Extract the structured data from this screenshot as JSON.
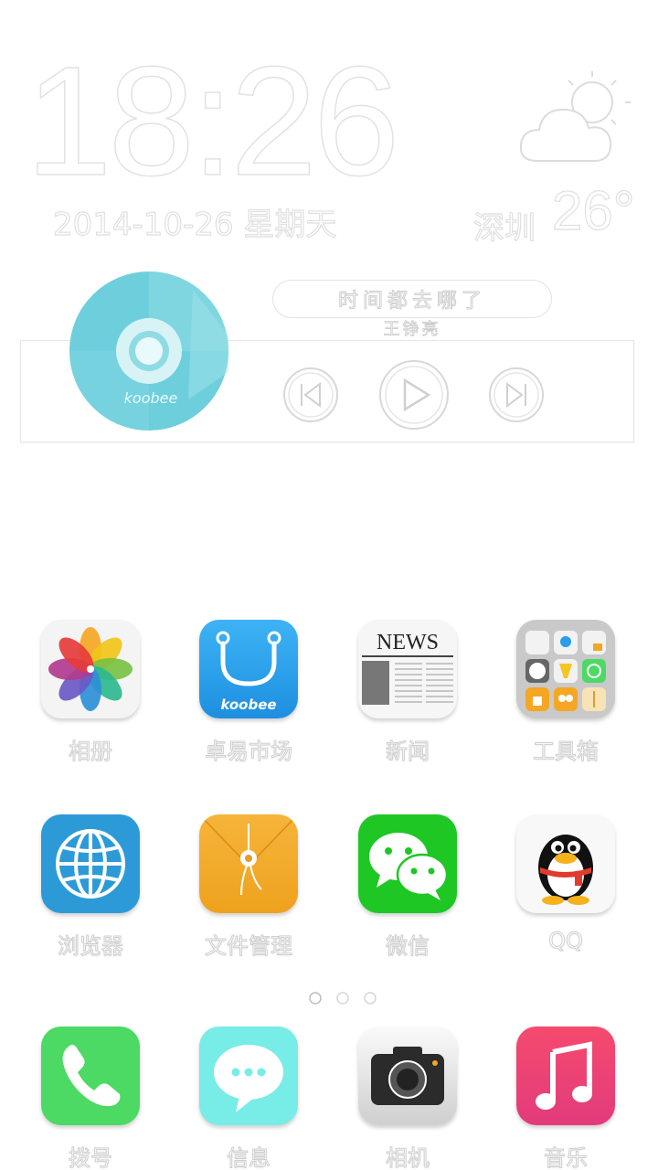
{
  "clock": {
    "time": "18:26",
    "date": "2014-10-26   星期天"
  },
  "weather": {
    "icon": "partly-cloudy-icon",
    "city": "深圳",
    "temperature": "26°"
  },
  "music": {
    "song_title": "时间都去哪了",
    "artist": "王铮亮",
    "disc_brand": "koobee",
    "state": "paused"
  },
  "apps": [
    {
      "label": "相册",
      "icon": "photos-icon"
    },
    {
      "label": "卓易市场",
      "icon": "koobee-market-icon",
      "brand": "koobee"
    },
    {
      "label": "新闻",
      "icon": "news-icon",
      "icon_text": "NEWS"
    },
    {
      "label": "工具箱",
      "icon": "toolbox-folder-icon"
    },
    {
      "label": "浏览器",
      "icon": "browser-globe-icon"
    },
    {
      "label": "文件管理",
      "icon": "file-manager-icon"
    },
    {
      "label": "微信",
      "icon": "wechat-icon"
    },
    {
      "label": "QQ",
      "icon": "qq-penguin-icon"
    }
  ],
  "page_indicator": {
    "pages": 3,
    "current": 1
  },
  "dock": [
    {
      "label": "拨号",
      "icon": "phone-icon"
    },
    {
      "label": "信息",
      "icon": "messages-icon"
    },
    {
      "label": "相机",
      "icon": "camera-icon"
    },
    {
      "label": "音乐",
      "icon": "music-icon"
    }
  ],
  "colors": {
    "disc": "#6ecfdc",
    "market": "#2a9ee8",
    "browser": "#2d9ad8",
    "file_manager": "#f0a928",
    "wechat": "#1ec724",
    "phone": "#4cd964",
    "messages": "#78ece6",
    "music": "#ee3f72"
  }
}
